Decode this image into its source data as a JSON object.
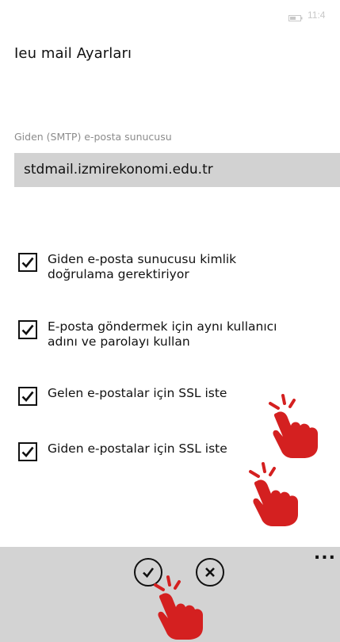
{
  "status": {
    "time": "11:4"
  },
  "header": {
    "title": "Ieu mail Ayarları"
  },
  "smtp": {
    "label": "Giden (SMTP) e-posta sunucusu",
    "value": "stdmail.izmirekonomi.edu.tr"
  },
  "options": [
    {
      "label_line1": "Giden e-posta sunucusu kimlik",
      "label_line2": "doğrulama gerektiriyor",
      "checked": true
    },
    {
      "label_line1": "E-posta göndermek için aynı kullanıcı",
      "label_line2": "adını ve parolayı kullan",
      "checked": true
    },
    {
      "label_line1": "Gelen e-postalar için SSL iste",
      "label_line2": "",
      "checked": true
    },
    {
      "label_line1": "Giden e-postalar için SSL iste",
      "label_line2": "",
      "checked": true
    }
  ],
  "appbar": {
    "more": "..."
  },
  "colors": {
    "input_bg": "#d2d2d2",
    "appbar_bg": "#d3d3d3",
    "hand": "#d42020"
  },
  "icons": [
    "battery-icon",
    "checkmark-icon",
    "done-icon",
    "cancel-icon",
    "pointing-hand-icon"
  ]
}
